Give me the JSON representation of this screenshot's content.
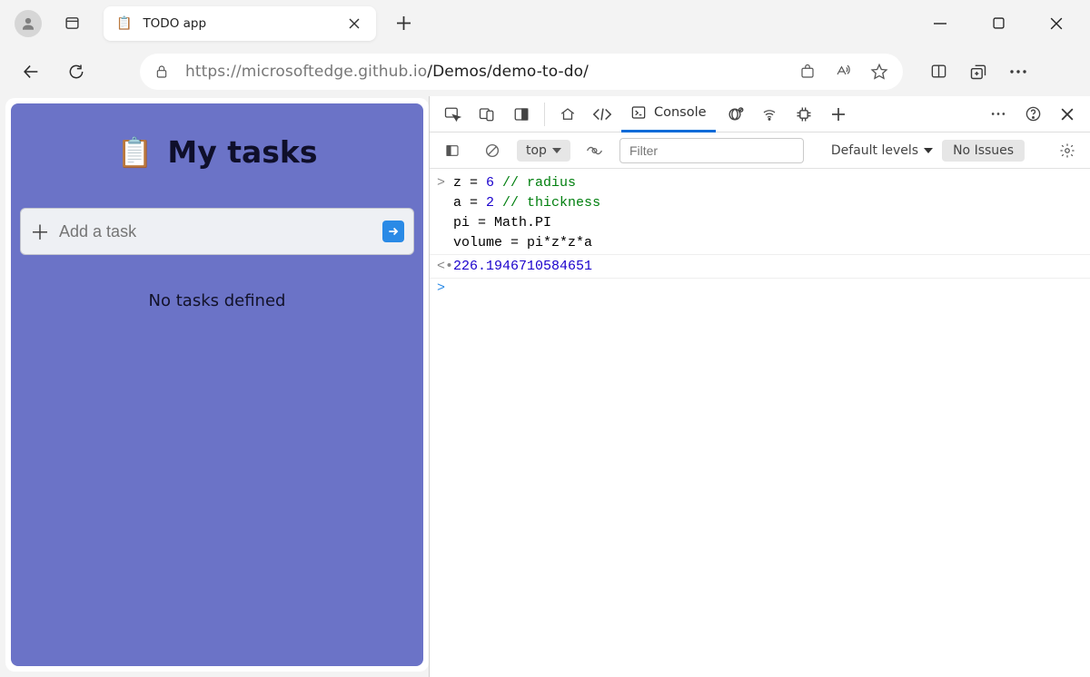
{
  "browser": {
    "tab_title": "TODO app",
    "url_host": "https://microsoftedge.github.io",
    "url_path": "/Demos/demo-to-do/"
  },
  "page": {
    "heading": "My tasks",
    "add_placeholder": "Add a task",
    "empty_msg": "No tasks defined"
  },
  "devtools": {
    "active_tab": "Console",
    "filter_placeholder": "Filter",
    "context": "top",
    "levels": "Default levels",
    "issues": "No Issues",
    "code_lines": [
      {
        "prefix": "z = ",
        "num": "6",
        "rest": " ",
        "comment": "// radius"
      },
      {
        "prefix": "a = ",
        "num": "2",
        "rest": " ",
        "comment": "// thickness"
      },
      {
        "prefix": "pi = Math.PI",
        "num": "",
        "rest": "",
        "comment": ""
      },
      {
        "prefix": "volume = pi*z*z*a",
        "num": "",
        "rest": "",
        "comment": ""
      }
    ],
    "output": "226.1946710584651"
  }
}
